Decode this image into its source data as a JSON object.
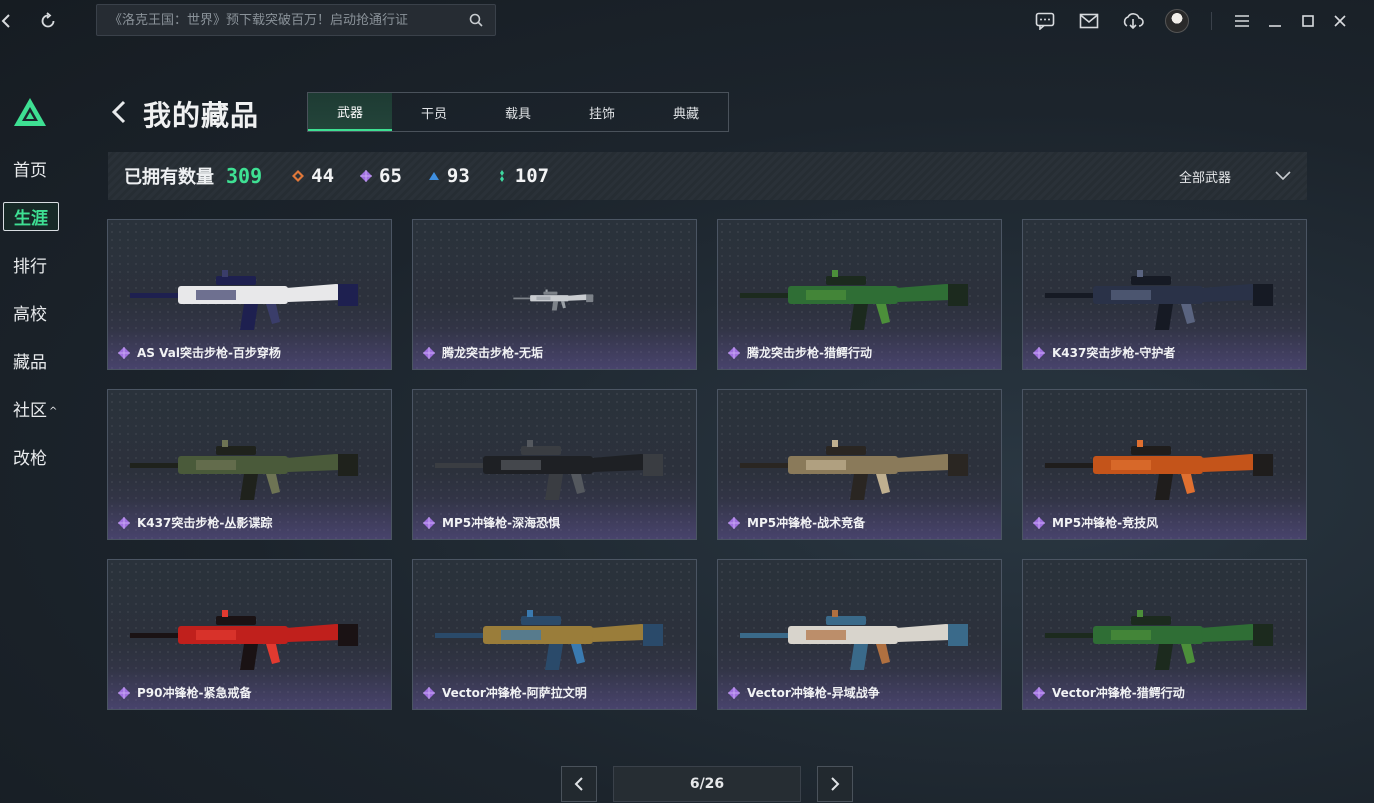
{
  "topbar": {
    "search_placeholder": "《洛克王国：世界》预下载突破百万！启动抢通行证",
    "icons": [
      "back-icon",
      "refresh-icon",
      "search-icon",
      "chat-icon",
      "mail-icon",
      "download-icon",
      "avatar",
      "menu-icon",
      "minimize-icon",
      "maximize-icon",
      "close-icon"
    ]
  },
  "nav": {
    "items": [
      {
        "label": "首页"
      },
      {
        "label": "生涯"
      },
      {
        "label": "排行"
      },
      {
        "label": "高校"
      },
      {
        "label": "藏品"
      },
      {
        "label": "社区"
      },
      {
        "label": "改枪"
      }
    ],
    "active": "生涯"
  },
  "header": {
    "title": "我的藏品",
    "tabs": [
      {
        "label": "武器"
      },
      {
        "label": "干员"
      },
      {
        "label": "载具"
      },
      {
        "label": "挂饰"
      },
      {
        "label": "典藏"
      }
    ],
    "active_tab": "武器"
  },
  "stats": {
    "owned_label": "已拥有数量",
    "owned_count": "309",
    "rarities": [
      {
        "icon": "orange-gem-icon",
        "color": "#e0783a",
        "value": "44"
      },
      {
        "icon": "purple-gem-icon",
        "color": "#a070e0",
        "value": "65"
      },
      {
        "icon": "blue-gem-icon",
        "color": "#3f8fe0",
        "value": "93"
      },
      {
        "icon": "green-gem-icon",
        "color": "#3ed9a0",
        "value": "107"
      }
    ],
    "filter_label": "全部武器"
  },
  "items": [
    {
      "name": "AS Val突击步枪-百步穿杨",
      "colors": [
        "#e8e8ea",
        "#1e2050",
        "#3a3d6a"
      ]
    },
    {
      "name": "腾龙突击步枪-无垢",
      "colors": [
        "#c9ccd0",
        "#7d8289",
        "#9aa0a6"
      ]
    },
    {
      "name": "腾龙突击步枪-猎鳄行动",
      "colors": [
        "#2f6e35",
        "#1c2a1e",
        "#4c8f3a"
      ]
    },
    {
      "name": "K437突击步枪-守护者",
      "colors": [
        "#2a3248",
        "#161a24",
        "#5a6480"
      ]
    },
    {
      "name": "K437突击步枪-丛影谍踪",
      "colors": [
        "#4a5a3a",
        "#1f221c",
        "#6e7454"
      ]
    },
    {
      "name": "MP5冲锋枪-深海恐惧",
      "colors": [
        "#1e2024",
        "#3a3d42",
        "#54585e"
      ]
    },
    {
      "name": "MP5冲锋枪-战术竞备",
      "colors": [
        "#8a7a5a",
        "#2a2622",
        "#c0b090"
      ]
    },
    {
      "name": "MP5冲锋枪-竞技风",
      "colors": [
        "#c4541a",
        "#1f1d1c",
        "#e07030"
      ]
    },
    {
      "name": "P90冲锋枪-紧急戒备",
      "colors": [
        "#c0201c",
        "#1a1214",
        "#e23a30"
      ]
    },
    {
      "name": "Vector冲锋枪-阿萨拉文明",
      "colors": [
        "#9a7d3a",
        "#2a4a6a",
        "#3a7ab0"
      ]
    },
    {
      "name": "Vector冲锋枪-异域战争",
      "colors": [
        "#d8d4cc",
        "#3a6a8a",
        "#b07040"
      ]
    },
    {
      "name": "Vector冲锋枪-猎鳄行动",
      "colors": [
        "#2f6e35",
        "#1c2a1e",
        "#4c8f3a"
      ]
    }
  ],
  "pager": {
    "page_text": "6/26"
  }
}
